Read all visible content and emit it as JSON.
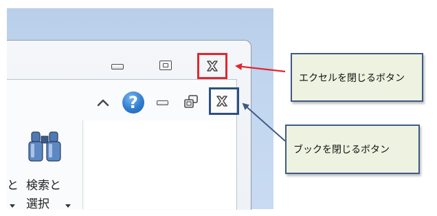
{
  "window": {
    "app_minimize": "minimize",
    "app_restore": "restore",
    "app_close": "close"
  },
  "workbook": {
    "ribbon_collapse": "collapse-ribbon",
    "help_glyph": "?",
    "minimize": "minimize",
    "restore": "restore",
    "close": "close"
  },
  "ribbon": {
    "partial_label_1": "と",
    "find_select_label_1": "検索と",
    "find_select_label_2": "選択"
  },
  "callouts": {
    "excel_close": "エクセルを閉じるボタン",
    "book_close": "ブックを閉じるボタン"
  },
  "colors": {
    "excel_close_highlight": "#e2262f",
    "book_close_highlight": "#2f4f7f",
    "callout_bg": "#eef2e0"
  },
  "icons": [
    "chevron-up-icon",
    "help-icon",
    "minimize-icon",
    "restore-icon",
    "close-icon",
    "binoculars-icon",
    "dropdown-arrow-icon"
  ]
}
